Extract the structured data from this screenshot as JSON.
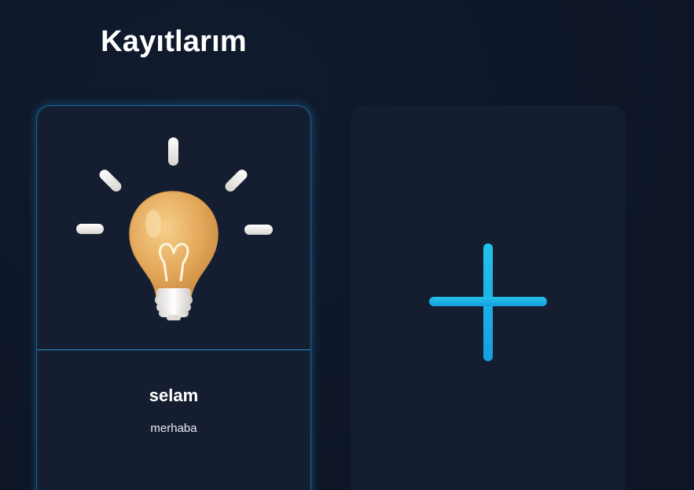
{
  "page": {
    "title": "Kayıtlarım"
  },
  "notes": [
    {
      "title": "selam",
      "description": "merhaba",
      "image_icon": "lightbulb-icon"
    }
  ],
  "add_card": {
    "icon": "plus-icon"
  },
  "colors": {
    "background": "#0e1628",
    "card": "#151e31",
    "accent": "#1eb6ea",
    "card_border": "#1d5f8c"
  }
}
